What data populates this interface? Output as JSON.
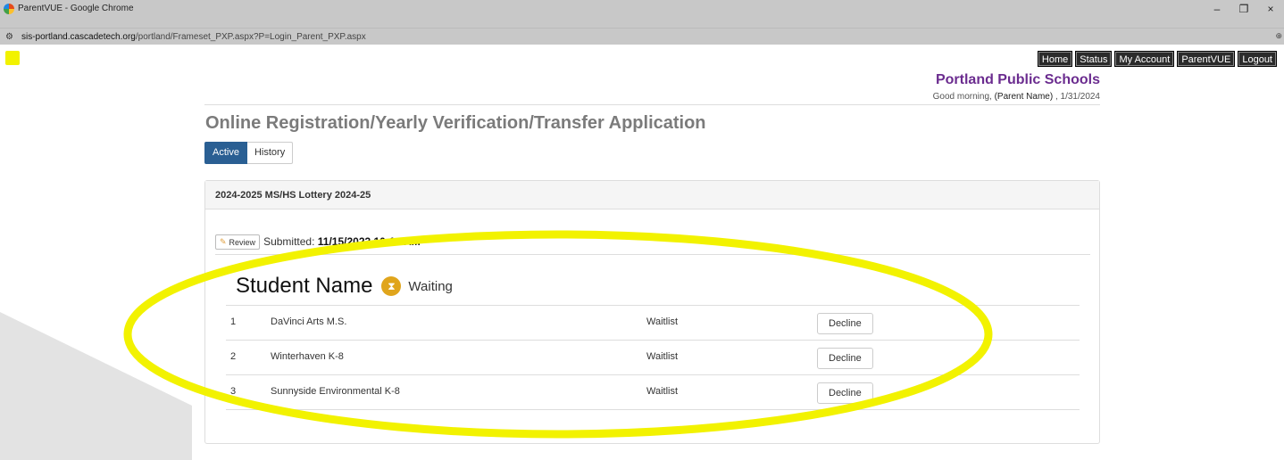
{
  "browser": {
    "window_title": "ParentVUE - Google Chrome",
    "url_host": "sis-portland.cascadetech.org",
    "url_path": "/portland/Frameset_PXP.aspx?P=Login_Parent_PXP.aspx",
    "controls": {
      "minimize": "–",
      "restore": "❐",
      "close": "×"
    },
    "right_glyph": "⊕"
  },
  "topnav": {
    "home": "Home",
    "status": "Status",
    "my_account": "My Account",
    "parentvue": "ParentVUE",
    "logout": "Logout"
  },
  "header": {
    "school": "Portland Public Schools",
    "greeting_prefix": "Good morning,",
    "parent_name": "(Parent Name)",
    "date": ", 1/31/2024"
  },
  "page": {
    "title": "Online Registration/Yearly Verification/Transfer Application",
    "tabs": {
      "active": "Active",
      "history": "History"
    }
  },
  "panel": {
    "heading": "2024-2025 MS/HS Lottery 2024-25",
    "review_label": "Review",
    "submitted_label": "Submitted:",
    "submitted_value": "11/15/2023 10:14 AM",
    "student_name": "Student Name",
    "student_status": "Waiting",
    "schools": [
      {
        "rank": "1",
        "name": "DaVinci Arts M.S.",
        "status": "Waitlist",
        "action": "Decline"
      },
      {
        "rank": "2",
        "name": "Winterhaven K-8",
        "status": "Waitlist",
        "action": "Decline"
      },
      {
        "rank": "3",
        "name": "Sunnyside Environmental K-8",
        "status": "Waitlist",
        "action": "Decline"
      }
    ]
  },
  "colors": {
    "brand_purple": "#6b2c8f",
    "tab_blue": "#2a5f93",
    "annotation_yellow": "#f2f200",
    "status_orange": "#e0a51c"
  }
}
